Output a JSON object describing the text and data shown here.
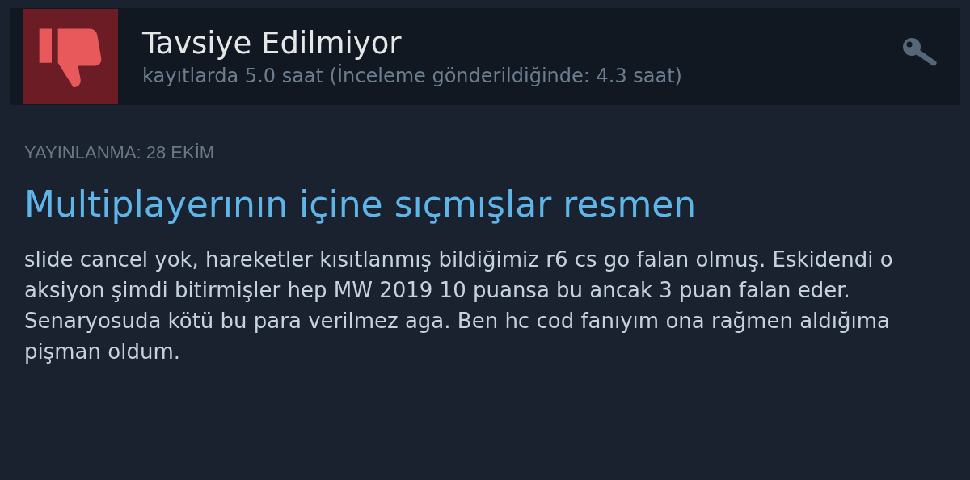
{
  "review": {
    "recommended": false,
    "verdict": "Tavsiye Edilmiyor",
    "hours": "kayıtlarda 5.0 saat (İnceleme gönderildiğinde: 4.3 saat)",
    "posted": "YAYINLANMA: 28 EKİM",
    "title": "Multiplayerının içine sıçmışlar resmen",
    "body": "slide cancel yok, hareketler kısıtlanmış bildiğimiz r6 cs go falan olmuş. Eskidendi o aksiyon şimdi bitirmişler hep MW 2019 10 puansa bu ancak 3 puan falan eder. Senaryosuda kötü bu para verilmez aga. Ben hc cod fanıyım ona rağmen aldığıma pişman oldum."
  }
}
